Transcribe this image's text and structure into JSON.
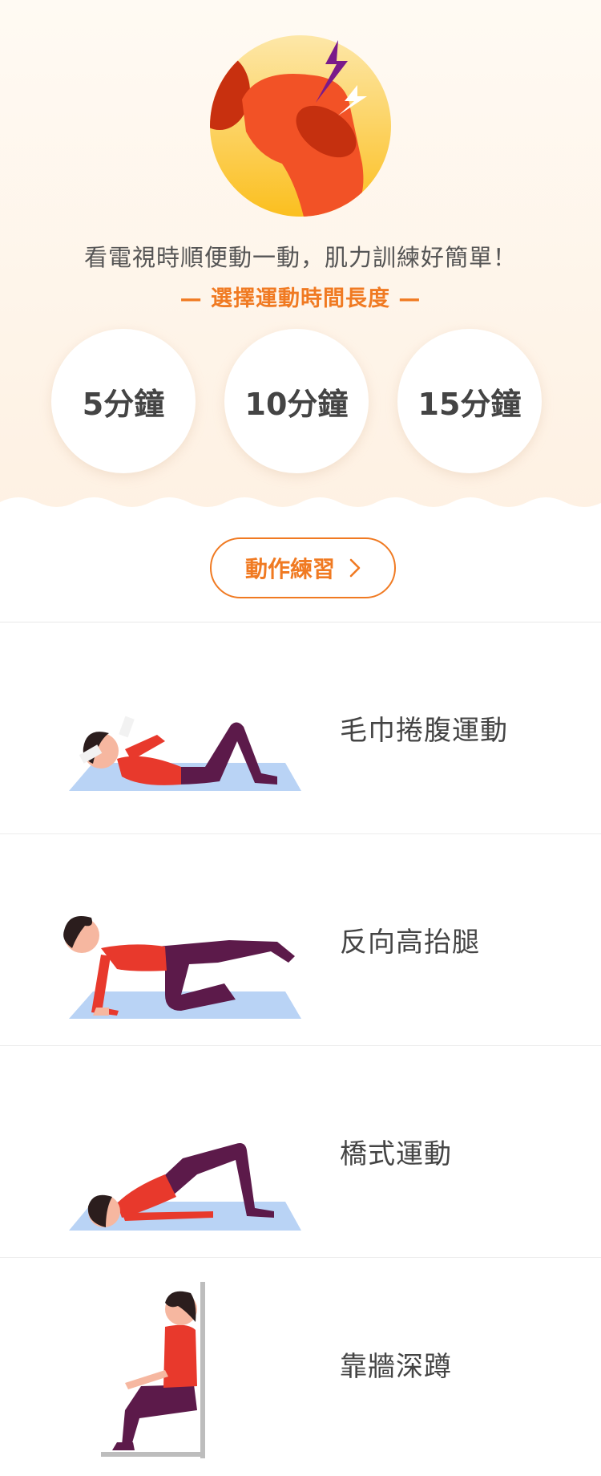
{
  "hero": {
    "tagline": "看電視時順便動一動，肌力訓練好簡單！",
    "subtitle": "— 選擇運動時間長度 —"
  },
  "durations": [
    {
      "label": "5分鐘"
    },
    {
      "label": "10分鐘"
    },
    {
      "label": "15分鐘"
    }
  ],
  "cta": {
    "label": "動作練習",
    "icon": "chevron-right-icon"
  },
  "exercises": [
    {
      "name": "毛巾捲腹運動",
      "icon": "towel-crunch-illustration"
    },
    {
      "name": "反向高抬腿",
      "icon": "reverse-leg-raise-illustration"
    },
    {
      "name": "橋式運動",
      "icon": "bridge-illustration"
    },
    {
      "name": "靠牆深蹲",
      "icon": "wall-squat-illustration"
    }
  ],
  "colors": {
    "accent": "#f07a22",
    "mat": "#b9d3f5",
    "shirt": "#e8392c",
    "pants": "#5c1a4a"
  }
}
